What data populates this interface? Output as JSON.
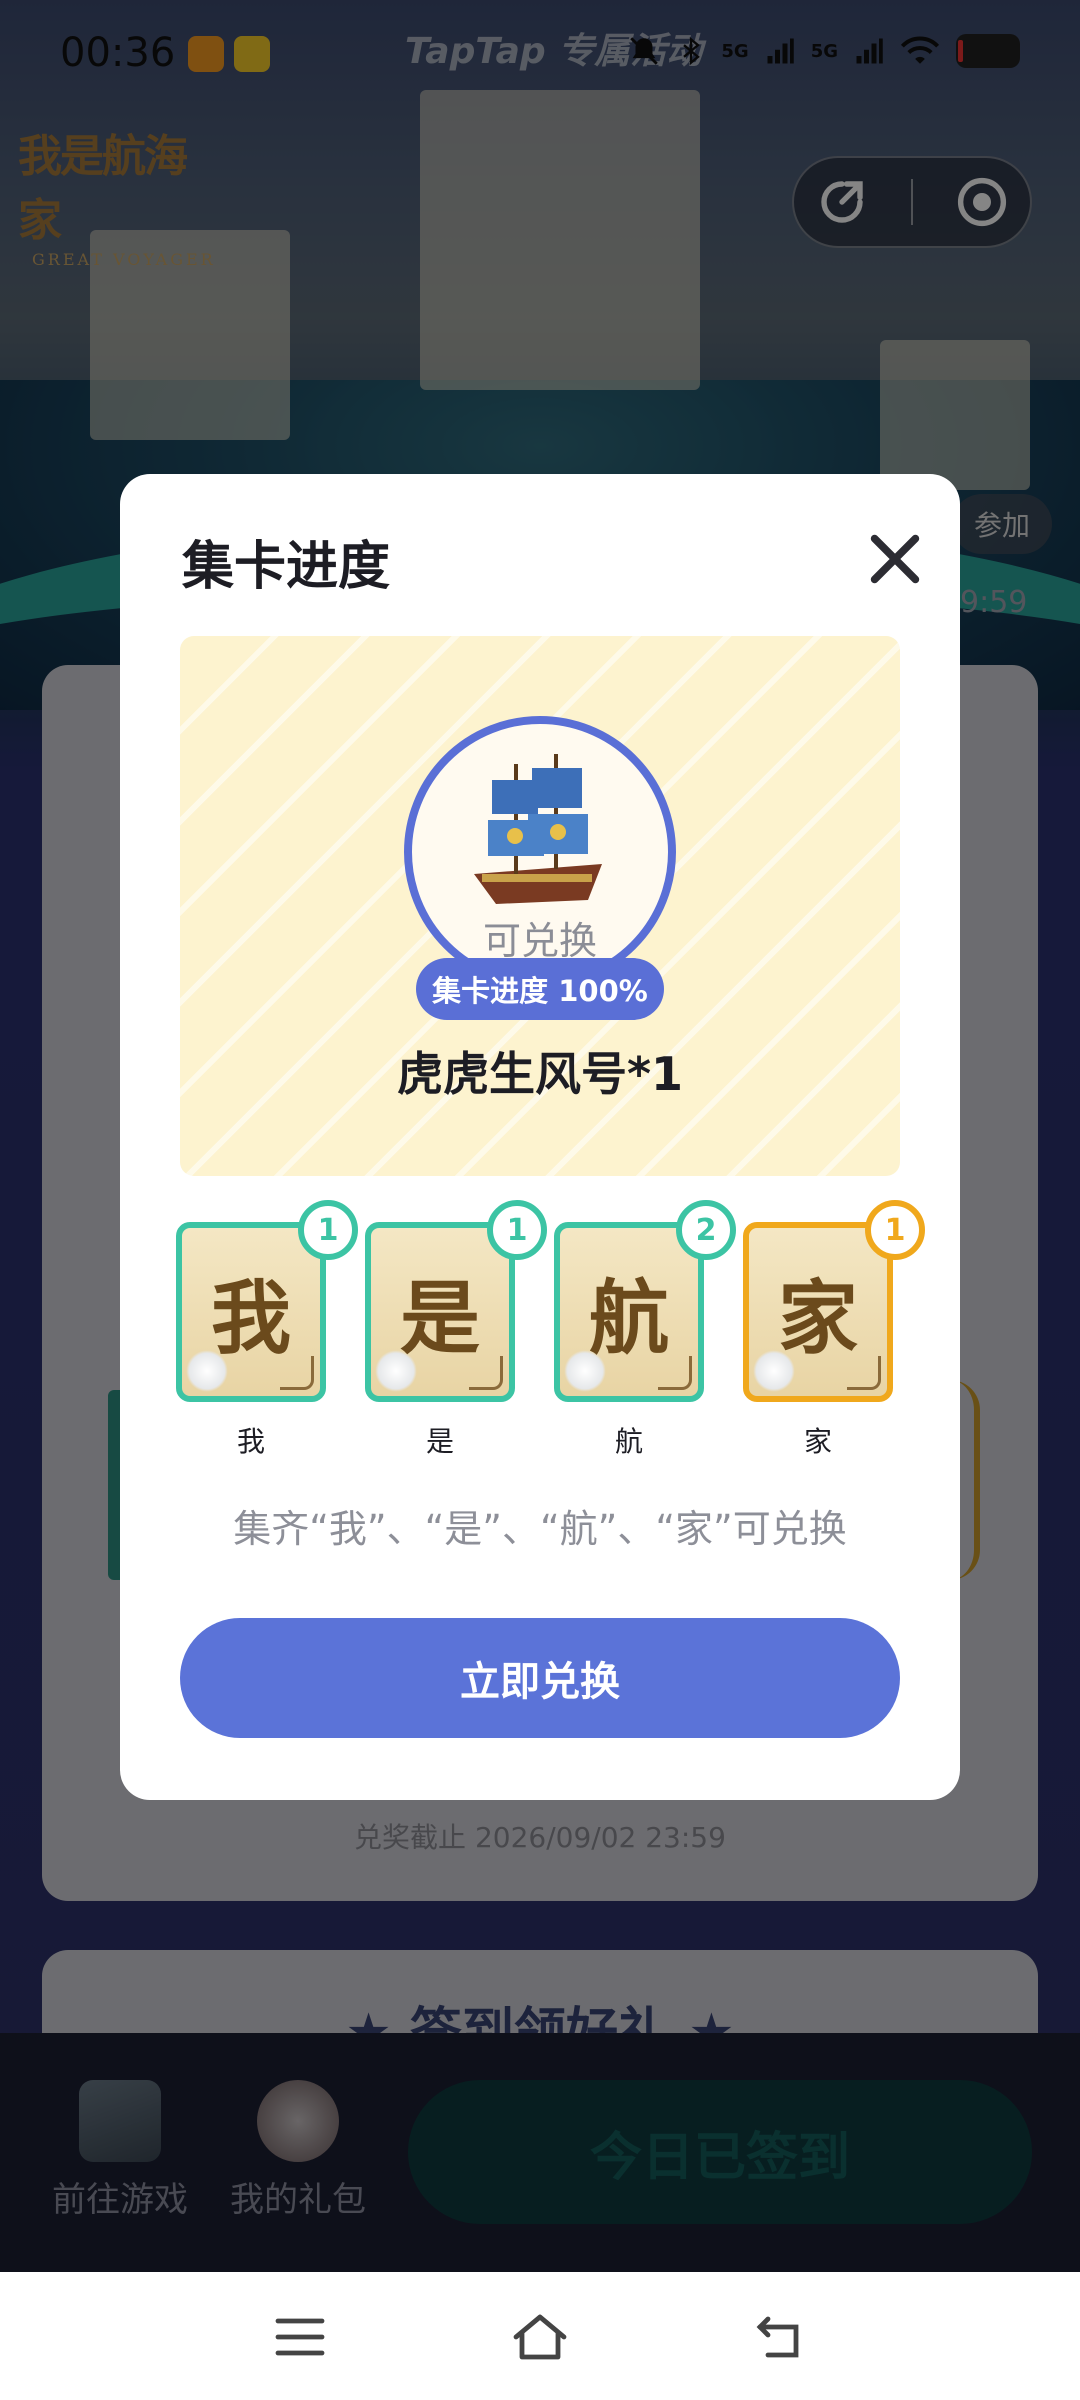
{
  "status_bar": {
    "time": "00:36",
    "header_text": "TapTap 专属活动",
    "signal_1": "5G",
    "signal_2": "5G"
  },
  "game_logo": {
    "title": "我是航海家",
    "subtitle": "GREAT VOYAGER"
  },
  "background": {
    "join_label": "参加",
    "timer_text": "9:59",
    "deadline_text": "兑奖截止 2026/09/02 23:59",
    "sign_section_title": "★ 签到领好礼 ★"
  },
  "bottom_bar": {
    "items": [
      {
        "label": "前往游戏"
      },
      {
        "label": "我的礼包"
      }
    ],
    "signed_button": "今日已签到"
  },
  "modal": {
    "title": "集卡进度",
    "reward": {
      "status": "可兑换",
      "progress_label": "集卡进度 100%",
      "progress_value": 1.0,
      "name": "虎虎生风号*1"
    },
    "cards": [
      {
        "char": "我",
        "label": "我",
        "count": "1",
        "color": "#3cc4a4"
      },
      {
        "char": "是",
        "label": "是",
        "count": "1",
        "color": "#3cc4a4"
      },
      {
        "char": "航",
        "label": "航",
        "count": "2",
        "color": "#3cc4a4"
      },
      {
        "char": "家",
        "label": "家",
        "count": "1",
        "color": "#f0a81c"
      }
    ],
    "hint": "集齐“我”、“是”、“航”、“家”可兑换",
    "redeem_button": "立即兑换"
  },
  "colors": {
    "accent": "#5b73d8",
    "teal": "#3cc4a4",
    "gold": "#f0a81c"
  }
}
